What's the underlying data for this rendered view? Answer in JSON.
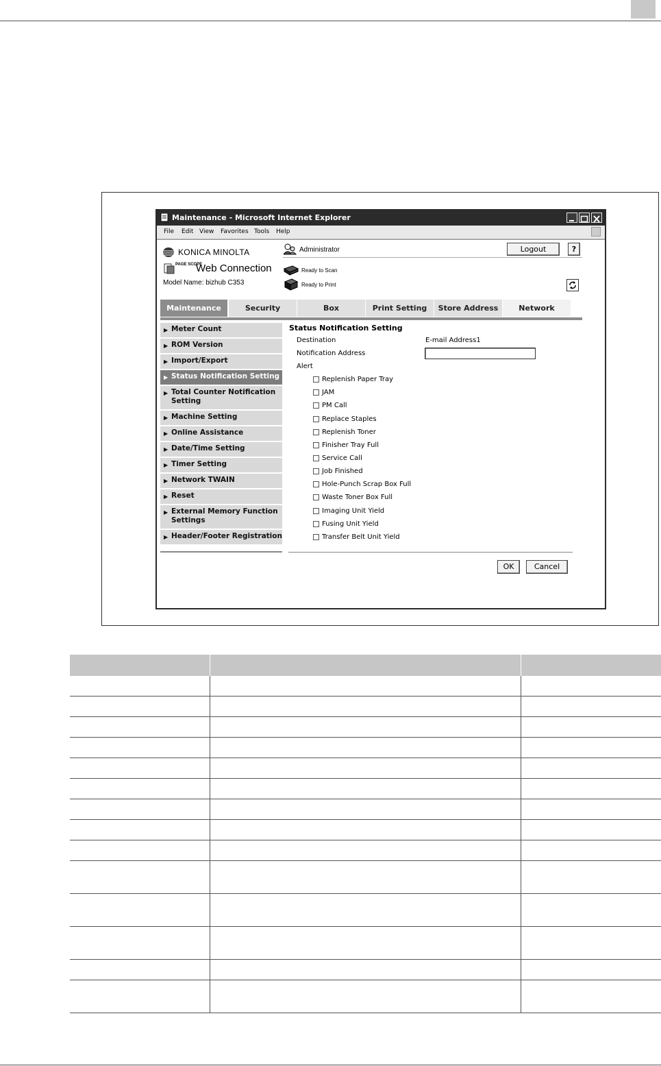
{
  "window": {
    "title": "Maintenance - Microsoft Internet Explorer",
    "menu": [
      "File",
      "Edit",
      "View",
      "Favorites",
      "Tools",
      "Help"
    ]
  },
  "header": {
    "brand": "KONICA MINOLTA",
    "product_prefix": "PAGE SCOPE",
    "product": "Web Connection",
    "model": "Model Name: bizhub C353",
    "user": "Administrator",
    "logout_label": "Logout",
    "help_label": "?",
    "scan_status": "Ready to Scan",
    "print_status": "Ready to Print"
  },
  "tabs": [
    "Maintenance",
    "Security",
    "Box",
    "Print Setting",
    "Store Address",
    "Network"
  ],
  "active_tab": "Maintenance",
  "sidebar": {
    "items": [
      "Meter Count",
      "ROM Version",
      "Import/Export",
      "Status Notification Setting",
      "Total Counter Notification Setting",
      "Machine Setting",
      "Online Assistance",
      "Date/Time Setting",
      "Timer Setting",
      "Network TWAIN",
      "Reset",
      "External Memory Function Settings",
      "Header/Footer Registration"
    ],
    "active": "Status Notification Setting"
  },
  "form": {
    "title": "Status Notification Setting",
    "destination_label": "Destination",
    "destination_value": "E-mail Address1",
    "address_label": "Notification Address",
    "address_value": "",
    "alert_label": "Alert",
    "alerts": [
      {
        "label": "Replenish Paper Tray",
        "checked": false
      },
      {
        "label": "JAM",
        "checked": false
      },
      {
        "label": "PM Call",
        "checked": false
      },
      {
        "label": "Replace Staples",
        "checked": false
      },
      {
        "label": "Replenish Toner",
        "checked": false
      },
      {
        "label": "Finisher Tray Full",
        "checked": false
      },
      {
        "label": "Service Call",
        "checked": false
      },
      {
        "label": "Job Finished",
        "checked": false
      },
      {
        "label": "Hole-Punch Scrap Box Full",
        "checked": false
      },
      {
        "label": "Waste Toner Box Full",
        "checked": false
      },
      {
        "label": "Imaging Unit Yield",
        "checked": false
      },
      {
        "label": "Fusing Unit Yield",
        "checked": false
      },
      {
        "label": "Transfer Belt Unit Yield",
        "checked": false
      }
    ],
    "ok_label": "OK",
    "cancel_label": "Cancel"
  },
  "colors": {
    "tab_active": "#8c8c8c",
    "sidebar_item": "#d9d9d9",
    "sidebar_active": "#7d7d7d",
    "title_bar": "#2b2b2b",
    "table_header": "#c6c6c6"
  }
}
